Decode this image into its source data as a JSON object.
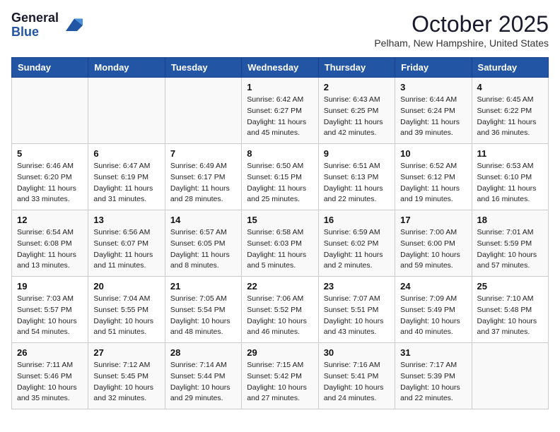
{
  "header": {
    "logo_general": "General",
    "logo_blue": "Blue",
    "month_year": "October 2025",
    "location": "Pelham, New Hampshire, United States"
  },
  "days_of_week": [
    "Sunday",
    "Monday",
    "Tuesday",
    "Wednesday",
    "Thursday",
    "Friday",
    "Saturday"
  ],
  "weeks": [
    [
      {
        "day": "",
        "info": ""
      },
      {
        "day": "",
        "info": ""
      },
      {
        "day": "",
        "info": ""
      },
      {
        "day": "1",
        "info": "Sunrise: 6:42 AM\nSunset: 6:27 PM\nDaylight: 11 hours\nand 45 minutes."
      },
      {
        "day": "2",
        "info": "Sunrise: 6:43 AM\nSunset: 6:25 PM\nDaylight: 11 hours\nand 42 minutes."
      },
      {
        "day": "3",
        "info": "Sunrise: 6:44 AM\nSunset: 6:24 PM\nDaylight: 11 hours\nand 39 minutes."
      },
      {
        "day": "4",
        "info": "Sunrise: 6:45 AM\nSunset: 6:22 PM\nDaylight: 11 hours\nand 36 minutes."
      }
    ],
    [
      {
        "day": "5",
        "info": "Sunrise: 6:46 AM\nSunset: 6:20 PM\nDaylight: 11 hours\nand 33 minutes."
      },
      {
        "day": "6",
        "info": "Sunrise: 6:47 AM\nSunset: 6:19 PM\nDaylight: 11 hours\nand 31 minutes."
      },
      {
        "day": "7",
        "info": "Sunrise: 6:49 AM\nSunset: 6:17 PM\nDaylight: 11 hours\nand 28 minutes."
      },
      {
        "day": "8",
        "info": "Sunrise: 6:50 AM\nSunset: 6:15 PM\nDaylight: 11 hours\nand 25 minutes."
      },
      {
        "day": "9",
        "info": "Sunrise: 6:51 AM\nSunset: 6:13 PM\nDaylight: 11 hours\nand 22 minutes."
      },
      {
        "day": "10",
        "info": "Sunrise: 6:52 AM\nSunset: 6:12 PM\nDaylight: 11 hours\nand 19 minutes."
      },
      {
        "day": "11",
        "info": "Sunrise: 6:53 AM\nSunset: 6:10 PM\nDaylight: 11 hours\nand 16 minutes."
      }
    ],
    [
      {
        "day": "12",
        "info": "Sunrise: 6:54 AM\nSunset: 6:08 PM\nDaylight: 11 hours\nand 13 minutes."
      },
      {
        "day": "13",
        "info": "Sunrise: 6:56 AM\nSunset: 6:07 PM\nDaylight: 11 hours\nand 11 minutes."
      },
      {
        "day": "14",
        "info": "Sunrise: 6:57 AM\nSunset: 6:05 PM\nDaylight: 11 hours\nand 8 minutes."
      },
      {
        "day": "15",
        "info": "Sunrise: 6:58 AM\nSunset: 6:03 PM\nDaylight: 11 hours\nand 5 minutes."
      },
      {
        "day": "16",
        "info": "Sunrise: 6:59 AM\nSunset: 6:02 PM\nDaylight: 11 hours\nand 2 minutes."
      },
      {
        "day": "17",
        "info": "Sunrise: 7:00 AM\nSunset: 6:00 PM\nDaylight: 10 hours\nand 59 minutes."
      },
      {
        "day": "18",
        "info": "Sunrise: 7:01 AM\nSunset: 5:59 PM\nDaylight: 10 hours\nand 57 minutes."
      }
    ],
    [
      {
        "day": "19",
        "info": "Sunrise: 7:03 AM\nSunset: 5:57 PM\nDaylight: 10 hours\nand 54 minutes."
      },
      {
        "day": "20",
        "info": "Sunrise: 7:04 AM\nSunset: 5:55 PM\nDaylight: 10 hours\nand 51 minutes."
      },
      {
        "day": "21",
        "info": "Sunrise: 7:05 AM\nSunset: 5:54 PM\nDaylight: 10 hours\nand 48 minutes."
      },
      {
        "day": "22",
        "info": "Sunrise: 7:06 AM\nSunset: 5:52 PM\nDaylight: 10 hours\nand 46 minutes."
      },
      {
        "day": "23",
        "info": "Sunrise: 7:07 AM\nSunset: 5:51 PM\nDaylight: 10 hours\nand 43 minutes."
      },
      {
        "day": "24",
        "info": "Sunrise: 7:09 AM\nSunset: 5:49 PM\nDaylight: 10 hours\nand 40 minutes."
      },
      {
        "day": "25",
        "info": "Sunrise: 7:10 AM\nSunset: 5:48 PM\nDaylight: 10 hours\nand 37 minutes."
      }
    ],
    [
      {
        "day": "26",
        "info": "Sunrise: 7:11 AM\nSunset: 5:46 PM\nDaylight: 10 hours\nand 35 minutes."
      },
      {
        "day": "27",
        "info": "Sunrise: 7:12 AM\nSunset: 5:45 PM\nDaylight: 10 hours\nand 32 minutes."
      },
      {
        "day": "28",
        "info": "Sunrise: 7:14 AM\nSunset: 5:44 PM\nDaylight: 10 hours\nand 29 minutes."
      },
      {
        "day": "29",
        "info": "Sunrise: 7:15 AM\nSunset: 5:42 PM\nDaylight: 10 hours\nand 27 minutes."
      },
      {
        "day": "30",
        "info": "Sunrise: 7:16 AM\nSunset: 5:41 PM\nDaylight: 10 hours\nand 24 minutes."
      },
      {
        "day": "31",
        "info": "Sunrise: 7:17 AM\nSunset: 5:39 PM\nDaylight: 10 hours\nand 22 minutes."
      },
      {
        "day": "",
        "info": ""
      }
    ]
  ]
}
